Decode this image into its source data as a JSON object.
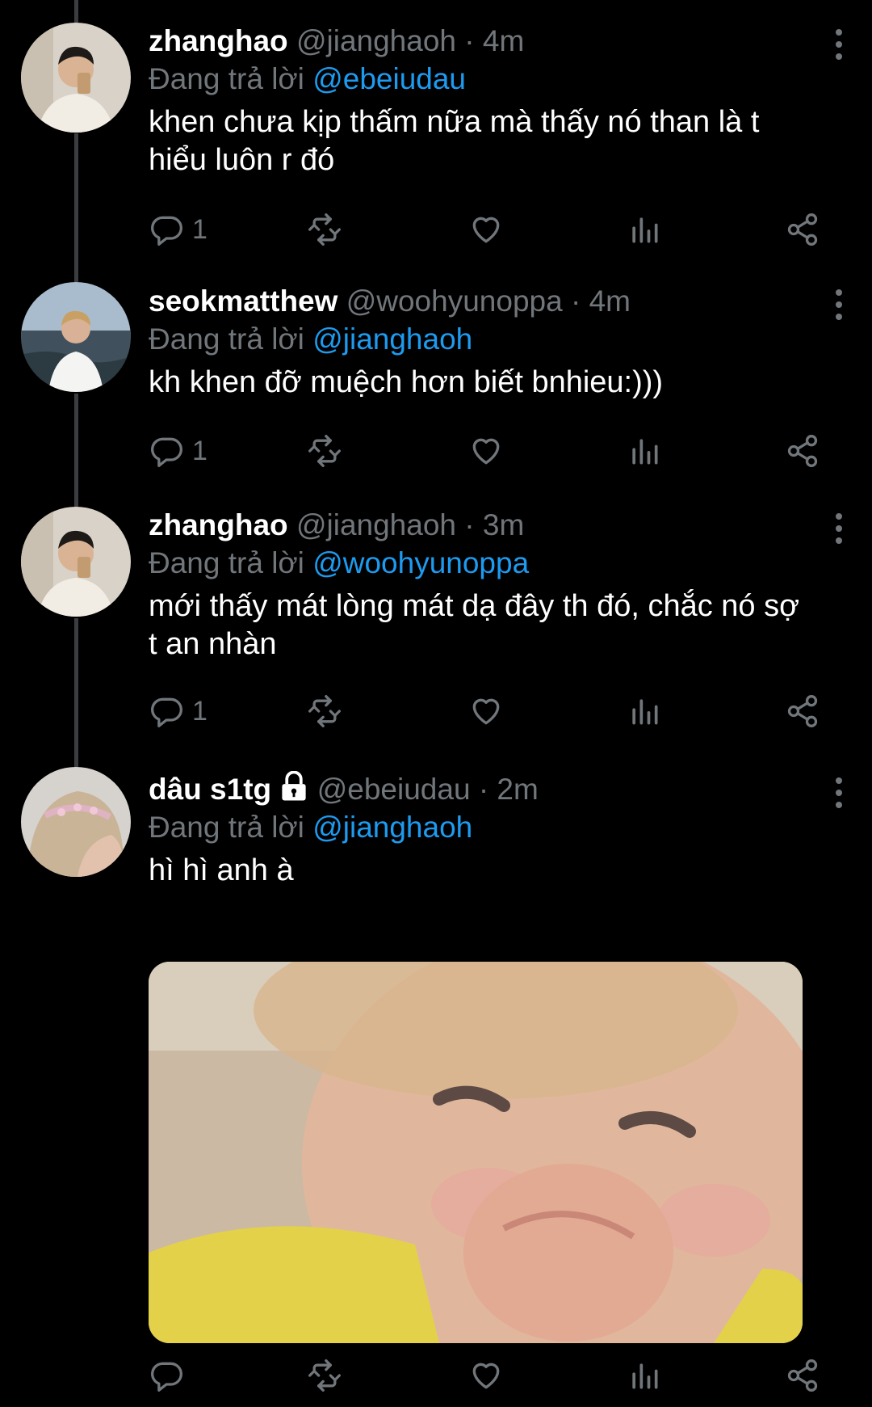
{
  "colors": {
    "background": "#000000",
    "text": "#e7e9ea",
    "muted": "#71767b",
    "accent": "#1d9bf0"
  },
  "tweets": [
    {
      "name": "zhanghao",
      "handle": "@jianghaoh",
      "time": "4m",
      "reply_prefix": "Đang trả lời",
      "reply_to": "@ebeiudau",
      "text_lines": [
        "khen chưa kịp thấm nữa mà thấy nó than là t",
        "hiểu luôn r đó"
      ],
      "reply_count": "1",
      "avatar": "selfie-man-avatar"
    },
    {
      "name": "seokmatthew",
      "handle": "@woohyunoppa",
      "time": "4m",
      "reply_prefix": "Đang trả lời",
      "reply_to": "@jianghaoh",
      "text_lines": [
        "kh khen đỡ muệch hơn biết bnhieu:)))"
      ],
      "reply_count": "1",
      "avatar": "beach-man-avatar"
    },
    {
      "name": "zhanghao",
      "handle": "@jianghaoh",
      "time": "3m",
      "reply_prefix": "Đang trả lời",
      "reply_to": "@woohyunoppa",
      "text_lines": [
        "mới thấy mát lòng mát dạ đây th đó, chắc nó sợ",
        "t an nhàn"
      ],
      "reply_count": "1",
      "avatar": "selfie-man-avatar"
    },
    {
      "name": "dâu s1tg",
      "handle": "@ebeiudau",
      "time": "2m",
      "reply_prefix": "Đang trả lời",
      "reply_to": "@jianghaoh",
      "text_lines": [
        "hì hì anh à"
      ],
      "reply_count": "",
      "avatar": "hair-clip-avatar",
      "locked": true
    }
  ],
  "icons": [
    "reply-icon",
    "retweet-icon",
    "like-icon",
    "views-icon",
    "share-icon",
    "more-icon",
    "lock-icon"
  ]
}
